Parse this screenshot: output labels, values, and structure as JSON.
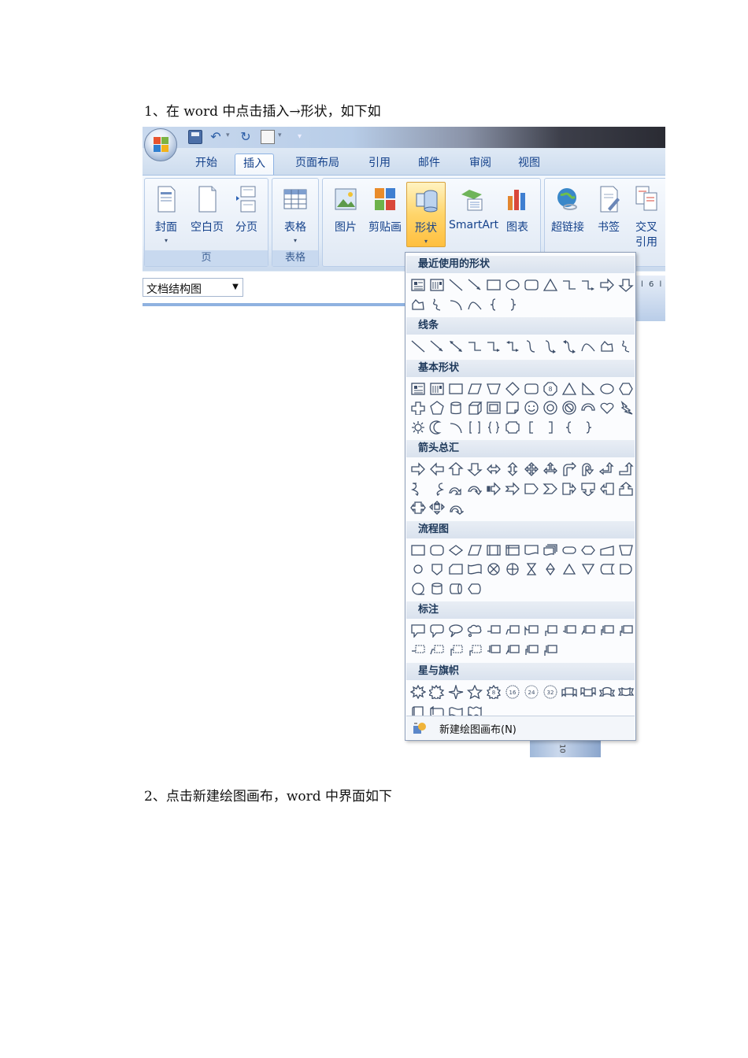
{
  "document": {
    "step1": "1、在 word 中点击插入→形状，如下如",
    "step2": "2、点击新建绘图画布，word 中界面如下"
  },
  "word": {
    "tabs": [
      {
        "label": "开始",
        "active": false
      },
      {
        "label": "插入",
        "active": true
      },
      {
        "label": "页面布局",
        "active": false
      },
      {
        "label": "引用",
        "active": false
      },
      {
        "label": "邮件",
        "active": false
      },
      {
        "label": "审阅",
        "active": false
      },
      {
        "label": "视图",
        "active": false
      }
    ],
    "groups": {
      "pages": {
        "label": "页",
        "buttons": [
          {
            "label": "封面",
            "has_dropdown": true,
            "icon": "cover-page-icon"
          },
          {
            "label": "空白页",
            "has_dropdown": false,
            "icon": "blank-page-icon"
          },
          {
            "label": "分页",
            "has_dropdown": false,
            "icon": "page-break-icon"
          }
        ]
      },
      "tables": {
        "label": "表格",
        "buttons": [
          {
            "label": "表格",
            "has_dropdown": true,
            "icon": "table-icon"
          }
        ]
      },
      "illustrations": {
        "buttons": [
          {
            "label": "图片",
            "icon": "picture-icon"
          },
          {
            "label": "剪贴画",
            "icon": "clipart-icon"
          },
          {
            "label": "形状",
            "has_dropdown": true,
            "icon": "shapes-icon",
            "highlighted": true
          },
          {
            "label": "SmartArt",
            "icon": "smartart-icon"
          },
          {
            "label": "图表",
            "icon": "chart-icon"
          }
        ]
      },
      "links": {
        "buttons": [
          {
            "label": "超链接",
            "icon": "hyperlink-icon"
          },
          {
            "label": "书签",
            "icon": "bookmark-icon"
          },
          {
            "label": "交叉",
            "label_line2": "引用",
            "icon": "cross-reference-icon"
          }
        ]
      }
    },
    "doc_map": {
      "label": "文档结构图"
    },
    "ruler_text": "l 6 l",
    "below_panel_text": "10"
  },
  "shape_panel": {
    "sections": [
      {
        "title": "最近使用的形状",
        "rows": [
          [
            "textbox",
            "vtextbox",
            "line",
            "arrow-line",
            "rect",
            "oval",
            "rounded-rect",
            "triangle",
            "elbow",
            "elbow-arrow",
            "right-arrow",
            "down-arrow"
          ],
          [
            "freeform",
            "scribble",
            "arc",
            "curve",
            "left-brace",
            "right-brace"
          ]
        ]
      },
      {
        "title": "线条",
        "rows": [
          [
            "line",
            "arrow-line",
            "double-arrow-line",
            "elbow",
            "elbow-arrow",
            "elbow-double-arrow",
            "curve-connector",
            "curve-arrow",
            "curve-double-arrow",
            "curve",
            "freeform",
            "scribble"
          ]
        ]
      },
      {
        "title": "基本形状",
        "rows": [
          [
            "textbox",
            "vtextbox",
            "rect",
            "parallelogram",
            "trapezoid",
            "diamond",
            "rounded-rect",
            "octagon",
            "triangle",
            "right-triangle",
            "oval",
            "hexagon"
          ],
          [
            "cross",
            "pentagon",
            "can",
            "cube",
            "bevel",
            "folded-corner",
            "smiley",
            "donut",
            "no-symbol",
            "block-arc",
            "heart",
            "lightning"
          ],
          [
            "sun",
            "moon",
            "arc",
            "bracket-pair",
            "brace-pair",
            "plaque",
            "left-bracket",
            "right-bracket",
            "left-brace",
            "right-brace"
          ]
        ]
      },
      {
        "title": "箭头总汇",
        "rows": [
          [
            "right-arrow",
            "left-arrow",
            "up-arrow",
            "down-arrow",
            "left-right-arrow",
            "up-down-arrow",
            "quad-arrow",
            "left-right-up-arrow",
            "bent-arrow",
            "u-turn-arrow",
            "left-up-arrow",
            "bent-up-arrow"
          ],
          [
            "curved-right-arrow",
            "curved-left-arrow",
            "curved-up-arrow",
            "curved-down-arrow",
            "striped-right-arrow",
            "notched-right-arrow",
            "pentagon-arrow",
            "chevron",
            "right-arrow-callout",
            "down-arrow-callout",
            "left-arrow-callout",
            "up-arrow-callout"
          ],
          [
            "left-right-arrow-callout",
            "quad-arrow-callout",
            "circular-arrow"
          ]
        ]
      },
      {
        "title": "流程图",
        "rows": [
          [
            "process",
            "alternate-process",
            "decision",
            "data",
            "predefined-process",
            "internal-storage",
            "document",
            "multidocument",
            "terminator",
            "preparation",
            "manual-input",
            "manual-operation"
          ],
          [
            "connector",
            "offpage-connector",
            "card",
            "punched-tape",
            "summing-junction",
            "or",
            "collate",
            "sort",
            "extract",
            "merge",
            "stored-data",
            "delay"
          ],
          [
            "sequential-access",
            "magnetic-disk",
            "direct-access",
            "display"
          ]
        ]
      },
      {
        "title": "标注",
        "rows": [
          [
            "rect-callout",
            "rounded-callout",
            "oval-callout",
            "cloud-callout",
            "line-callout-1",
            "line-callout-2",
            "line-callout-3",
            "line-callout-4",
            "accent-callout-1",
            "accent-callout-2",
            "accent-callout-3",
            "accent-callout-4"
          ],
          [
            "border-callout-1",
            "border-callout-2",
            "border-callout-3",
            "border-callout-4",
            "accent-border-1",
            "accent-border-2",
            "accent-border-3",
            "accent-border-4"
          ]
        ]
      },
      {
        "title": "星与旗帜",
        "rows": [
          [
            "explosion-1",
            "explosion-2",
            "star-4",
            "star-5",
            "star-8",
            "star-16",
            "star-24",
            "star-32",
            "ribbon-up",
            "ribbon-down",
            "curved-ribbon-up",
            "curved-ribbon-down"
          ],
          [
            "vertical-scroll",
            "horizontal-scroll",
            "wave",
            "double-wave"
          ]
        ]
      }
    ],
    "new_canvas_label": "新建绘图画布(N)"
  }
}
